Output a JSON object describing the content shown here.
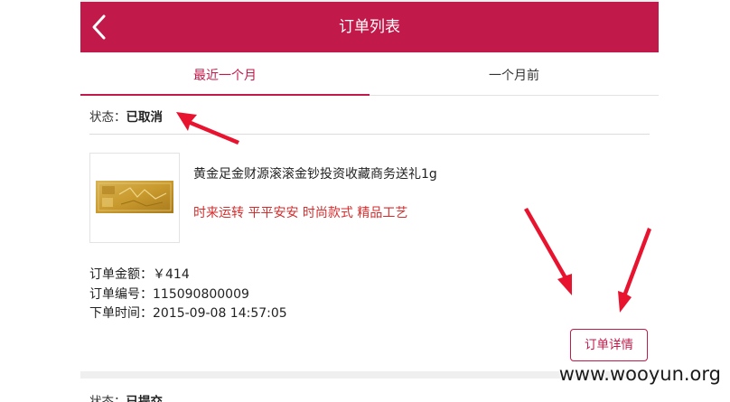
{
  "header": {
    "title": "订单列表",
    "back_icon": "chevron-left-icon"
  },
  "tabs": [
    {
      "label": "最近一个月",
      "active": true
    },
    {
      "label": "一个月前",
      "active": false
    }
  ],
  "orders": [
    {
      "status_label": "状态：",
      "status_value": "已取消",
      "product": {
        "name": "黄金足金财源滚滚金钞投资收藏商务送礼1g",
        "tags": "时来运转 平平安安 时尚款式 精品工艺"
      },
      "amount": "订单金额：￥414",
      "order_no": "订单编号：115090800009",
      "time": "下单时间：2015-09-08 14:57:05",
      "detail_button": "订单详情"
    },
    {
      "status_label": "状态：",
      "status_value": "已提交"
    }
  ],
  "watermark": "www.wooyun.org",
  "colors": {
    "brand": "#c0194a",
    "tag_red": "#d42d2d",
    "arrow_red": "#e8142f"
  }
}
